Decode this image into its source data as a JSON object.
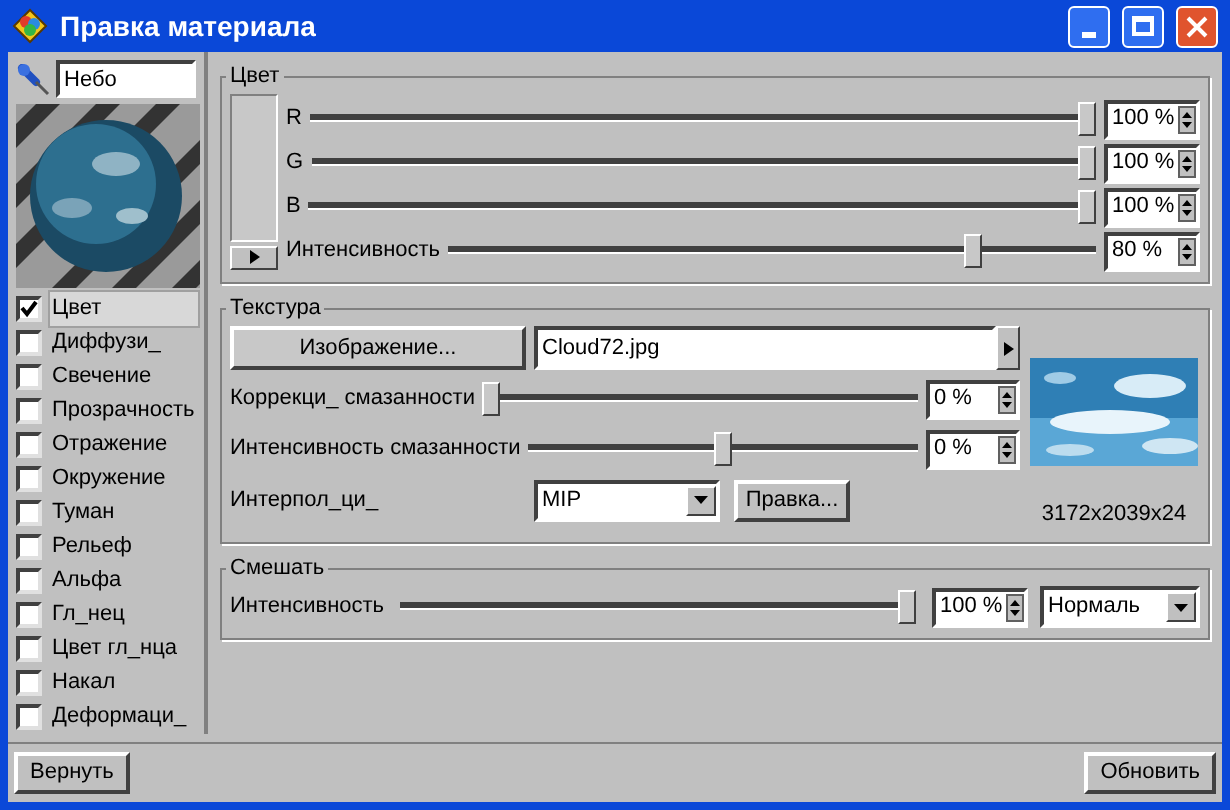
{
  "window": {
    "title": "Правка материала"
  },
  "material_name": {
    "value": "Небо"
  },
  "channels": [
    {
      "label": "Цвет",
      "checked": true,
      "selected": true
    },
    {
      "label": "Диффузи_",
      "checked": false,
      "selected": false
    },
    {
      "label": "Свечение",
      "checked": false,
      "selected": false
    },
    {
      "label": "Прозрачность",
      "checked": false,
      "selected": false
    },
    {
      "label": "Отражение",
      "checked": false,
      "selected": false
    },
    {
      "label": "Окружение",
      "checked": false,
      "selected": false
    },
    {
      "label": "Туман",
      "checked": false,
      "selected": false
    },
    {
      "label": "Рельеф",
      "checked": false,
      "selected": false
    },
    {
      "label": "Альфа",
      "checked": false,
      "selected": false
    },
    {
      "label": "Гл_нец",
      "checked": false,
      "selected": false
    },
    {
      "label": "Цвет гл_нца",
      "checked": false,
      "selected": false
    },
    {
      "label": "Накал",
      "checked": false,
      "selected": false
    },
    {
      "label": "Деформаци_",
      "checked": false,
      "selected": false
    }
  ],
  "color": {
    "title": "Цвет",
    "rows": [
      {
        "label": "R",
        "level": 1,
        "value": "100 %"
      },
      {
        "label": "G",
        "level": 1,
        "value": "100 %"
      },
      {
        "label": "B",
        "level": 1,
        "value": "100 %"
      },
      {
        "label": "Интенсивность",
        "level": 0.82,
        "value": "80 %"
      }
    ]
  },
  "texture": {
    "title": "Текстура",
    "image_button": "Изображение...",
    "file": "Cloud72.jpg",
    "rows": [
      {
        "label": "Коррекци_ смазанности",
        "level": 0,
        "value": "0 %"
      },
      {
        "label": "Интенсивность смазанности",
        "level": 0.5,
        "value": "0 %"
      }
    ],
    "interpolation": {
      "label": "Интерпол_ци_",
      "value": "MIP"
    },
    "edit_button": "Правка...",
    "image_size": "3172x2039x24"
  },
  "mix": {
    "title": "Смешать",
    "label": "Интенсивность",
    "level": 1,
    "value": "100 %",
    "mode": "Нормаль"
  },
  "buttons": [
    "Вернуть",
    "Обновить"
  ]
}
